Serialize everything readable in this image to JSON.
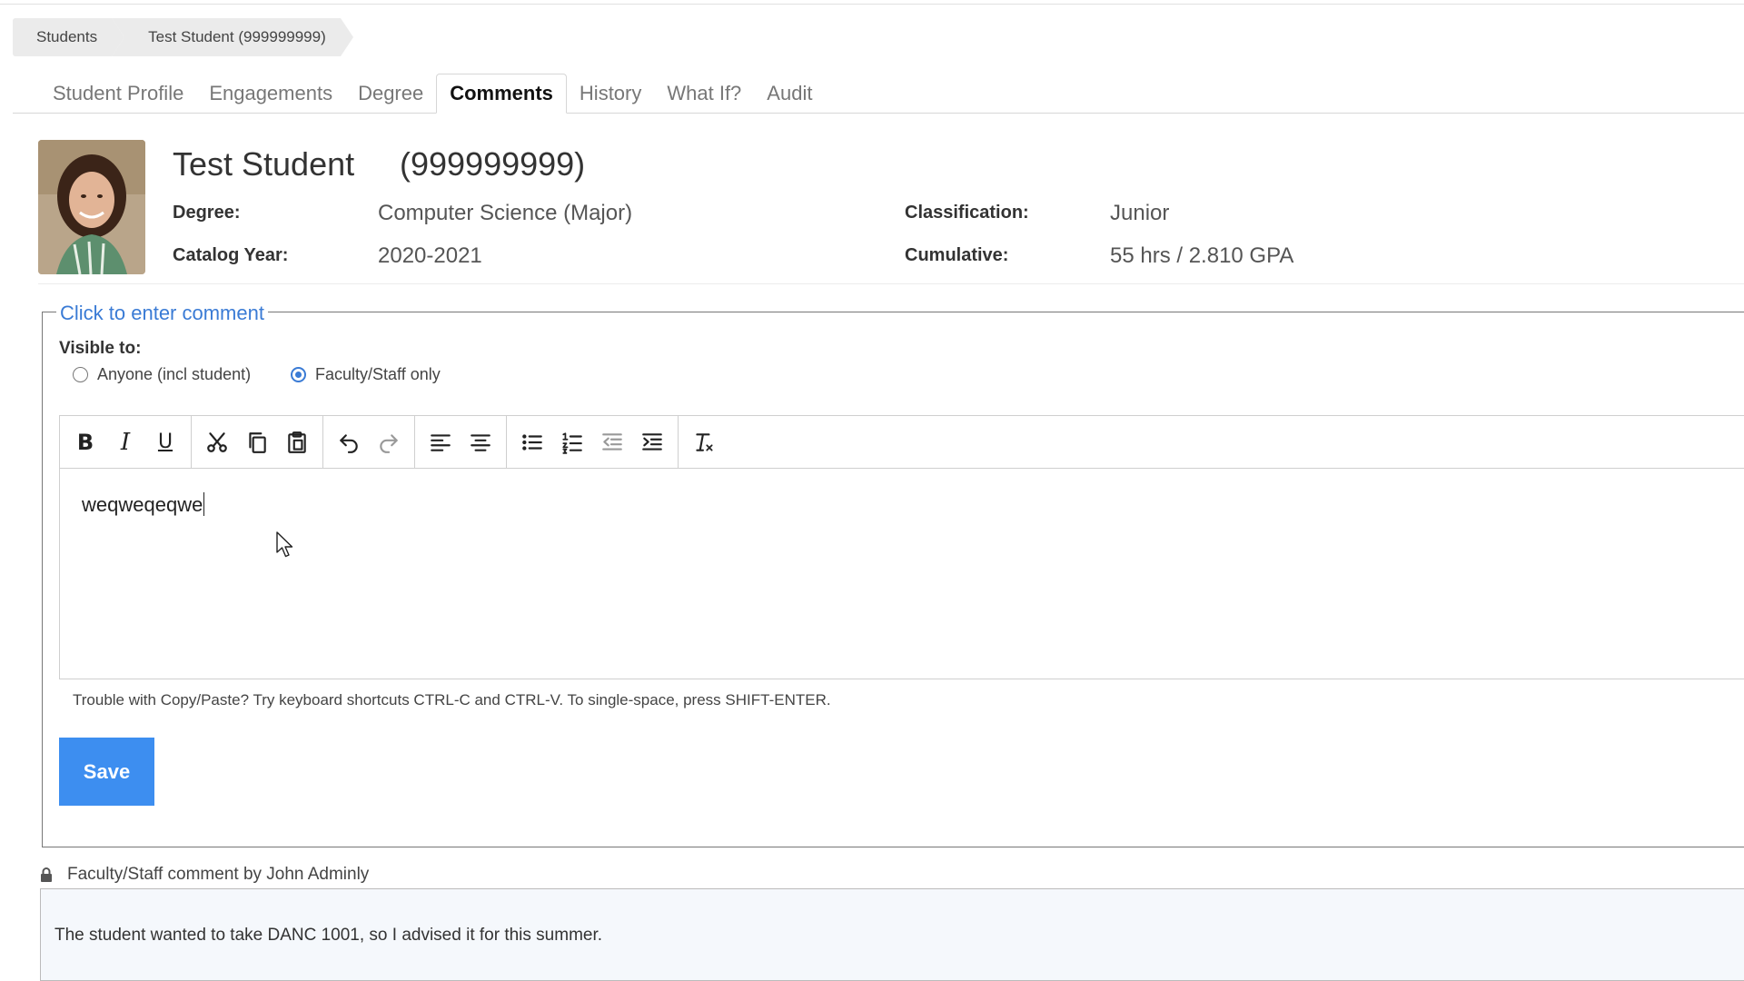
{
  "breadcrumb": [
    "Students",
    "Test Student (999999999)"
  ],
  "tabs": [
    {
      "label": "Student Profile",
      "active": false
    },
    {
      "label": "Engagements",
      "active": false
    },
    {
      "label": "Degree",
      "active": false
    },
    {
      "label": "Comments",
      "active": true
    },
    {
      "label": "History",
      "active": false
    },
    {
      "label": "What If?",
      "active": false
    },
    {
      "label": "Audit",
      "active": false
    }
  ],
  "student": {
    "name": "Test Student",
    "id": "(999999999)",
    "degree_label": "Degree:",
    "degree_value": "Computer Science (Major)",
    "catalog_label": "Catalog Year:",
    "catalog_value": "2020-2021",
    "classification_label": "Classification:",
    "classification_value": "Junior",
    "cumulative_label": "Cumulative:",
    "cumulative_value": "55 hrs / 2.810 GPA"
  },
  "comment_form": {
    "legend": "Click to enter comment",
    "visible_to_label": "Visible to:",
    "options": [
      {
        "label": "Anyone (incl student)",
        "checked": false
      },
      {
        "label": "Faculty/Staff only",
        "checked": true
      }
    ],
    "editor_text": "weqweqeqwe",
    "hint": "Trouble with Copy/Paste? Try keyboard shortcuts CTRL-C and CTRL-V. To single-space, press SHIFT-ENTER.",
    "save_label": "Save"
  },
  "toolbar_icons": [
    "bold-icon",
    "italic-icon",
    "underline-icon",
    "cut-icon",
    "copy-icon",
    "paste-icon",
    "undo-icon",
    "redo-icon",
    "align-left-icon",
    "align-center-icon",
    "bullet-list-icon",
    "numbered-list-icon",
    "outdent-icon",
    "indent-icon",
    "clear-format-icon"
  ],
  "existing_comment": {
    "meta": "Faculty/Staff comment by John Adminly",
    "text": "The student wanted to take DANC 1001, so I advised it for this summer."
  },
  "colors": {
    "accent": "#3a7bd5",
    "save_button": "#3d8ef0"
  }
}
